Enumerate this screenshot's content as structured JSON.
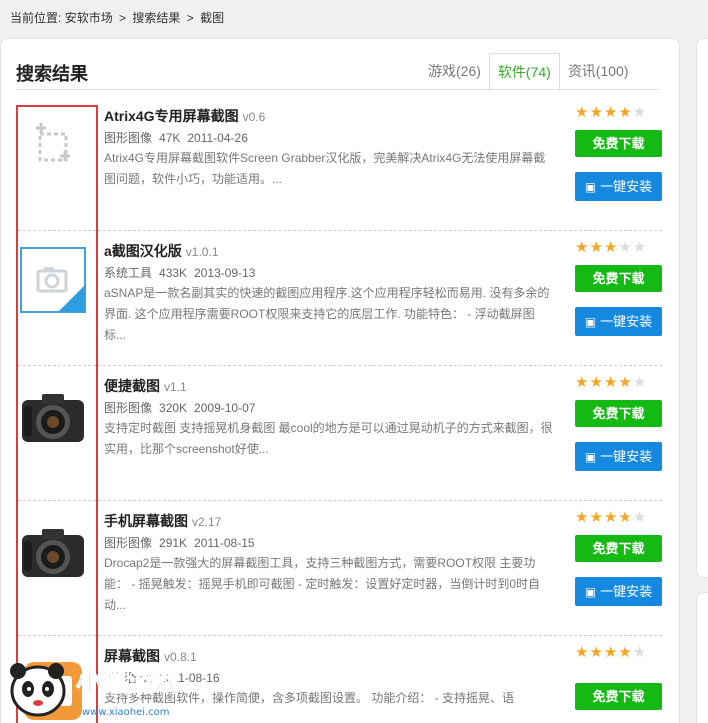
{
  "breadcrumb": {
    "prefix": "当前位置:",
    "items": [
      "安软市场",
      "搜索结果",
      "截图"
    ],
    "sep": ">"
  },
  "title": "搜索结果",
  "tabs": [
    {
      "label": "游戏(26)",
      "active": false
    },
    {
      "label": "软件(74)",
      "active": true
    },
    {
      "label": "资讯(100)",
      "active": false
    }
  ],
  "buttons": {
    "free": "免费下载",
    "install": "一键安装"
  },
  "items": [
    {
      "name": "Atrix4G专用屏幕截图",
      "version": "v0.6",
      "category": "图形图像",
      "size": "47K",
      "date": "2011-04-26",
      "desc": "Atrix4G专用屏幕截图软件Screen Grabber汉化版，完美解决Atrix4G无法使用屏幕截图问题，软件小巧，功能适用。...",
      "rating": 4,
      "icon": "crop-icon"
    },
    {
      "name": "a截图汉化版",
      "version": "v1.0.1",
      "category": "系统工具",
      "size": "433K",
      "date": "2013-09-13",
      "desc": "aSNAP是一款名副其实的快速的截图应用程序.这个应用程序轻松而易用. 没有多余的界面. 这个应用程序需要ROOT权限来支持它的底层工作. 功能特色： - 浮动截屏图标...",
      "rating": 3,
      "icon": "camera-icon"
    },
    {
      "name": "便捷截图",
      "version": "v1.1",
      "category": "图形图像",
      "size": "320K",
      "date": "2009-10-07",
      "desc": "支持定时截图 支持摇晃机身截图 最cool的地方是可以通过晃动机子的方式来截图，很实用，比那个screenshot好使...",
      "rating": 4,
      "icon": "dslr-camera-icon"
    },
    {
      "name": "手机屏幕截图",
      "version": "v2.17",
      "category": "图形图像",
      "size": "291K",
      "date": "2011-08-15",
      "desc": "Drocap2是一款强大的屏幕截图工具，支持三种截图方式，需要ROOT权限 主要功能： - 摇晃触发：摇晃手机即可截图 - 定时触发：设置好定时器，当倒计时到0时自动...",
      "rating": 4,
      "icon": "dslr-camera-icon"
    },
    {
      "name": "屏幕截图",
      "version": "v0.8.1",
      "category": "图形图像",
      "size": "",
      "date": "2011-08-16",
      "desc": "支持多种截图软件，操作简便，含多项截图设置。 功能介绍： - 支持摇晃、语",
      "rating": 4,
      "icon": "app-icon"
    }
  ],
  "watermark": {
    "text": "小黑游戏",
    "url": "www.xiaohei.com"
  }
}
